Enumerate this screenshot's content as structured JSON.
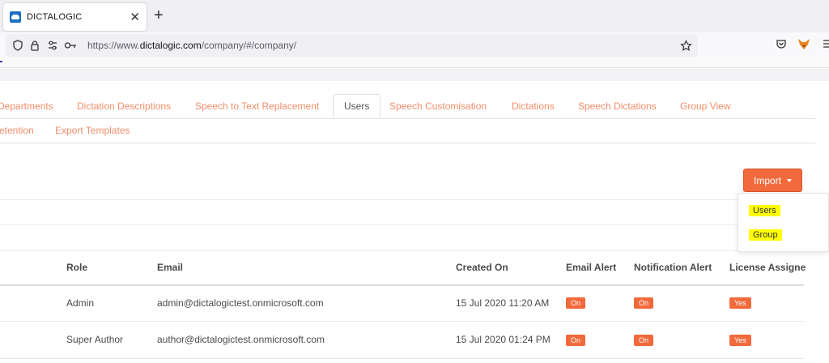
{
  "browser": {
    "tab_title": "DICTALOGIC",
    "url_prefix": "https://www.",
    "url_domain": "dictalogic.com",
    "url_path": "/company/#/company/",
    "icons": [
      "shield-icon",
      "lock-icon",
      "permissions-icon",
      "key-icon",
      "star-icon",
      "pocket-icon",
      "fox-extension-icon",
      "menu-icon"
    ]
  },
  "tabs": {
    "departments": "Departments",
    "dictation_descriptions": "Dictation Descriptions",
    "speech_to_text": "Speech to Text Replacement",
    "users": "Users",
    "speech_customisation": "Speech Customisation",
    "dictations": "Dictations",
    "speech_dictations": "Speech Dictations",
    "group_view": "Group View",
    "retention": "etention",
    "export_templates": "Export Templates"
  },
  "import": {
    "label": "Import",
    "options": [
      "Users",
      "Group"
    ]
  },
  "table": {
    "headers": {
      "role": "Role",
      "email": "Email",
      "created_on": "Created On",
      "email_alert": "Email Alert",
      "notification_alert": "Notification Alert",
      "license_assigned": "License Assigne"
    },
    "rows": [
      {
        "role": "Admin",
        "email": "admin@dictalogictest.onmicrosoft.com",
        "created_on": "15 Jul 2020 11:20 AM",
        "email_alert": "On",
        "notification_alert": "On",
        "license": "Yes"
      },
      {
        "role": "Super Author",
        "email": "author@dictalogictest.onmicrosoft.com",
        "created_on": "15 Jul 2020 01:24 PM",
        "email_alert": "On",
        "notification_alert": "On",
        "license": "Yes"
      }
    ]
  },
  "colors": {
    "accent": "#f26a3c",
    "tab_text": "#f08d6a",
    "highlight": "#ffff00"
  }
}
